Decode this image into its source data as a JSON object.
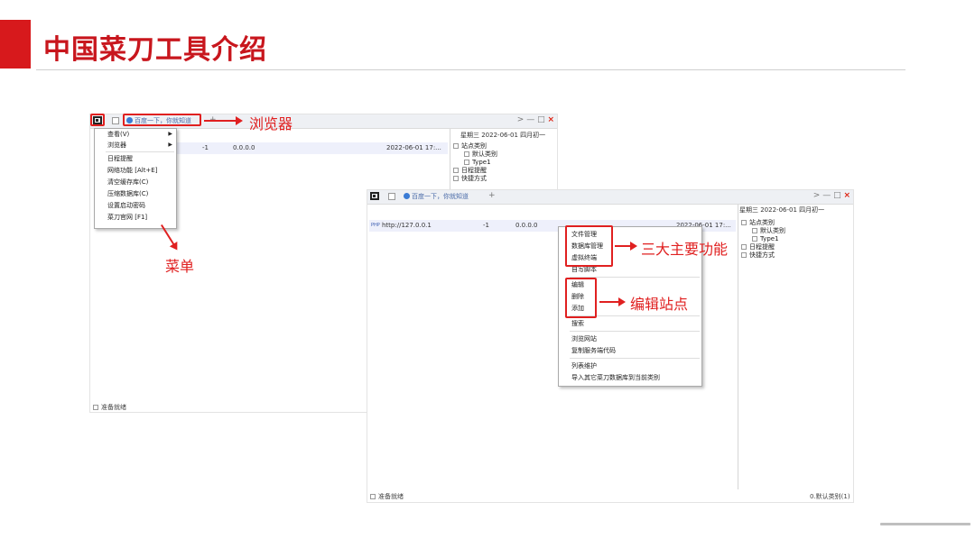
{
  "slide": {
    "title": "中国菜刀工具介绍"
  },
  "window1": {
    "tab_label": "百度一下，你就知道",
    "tab_plus": "+",
    "window_controls": {
      "forward": ">",
      "minimize": "—",
      "maximize": "□",
      "close": "×"
    },
    "date_text": "星期三 2022-06-01 四月初一",
    "row": {
      "num": "-1",
      "ip": "0.0.0.0",
      "time": "2022-06-01 17:..."
    },
    "tree": [
      "站点类别",
      "默认类别",
      "Type1",
      "日程提醒",
      "快捷方式"
    ],
    "status": "准备就绪",
    "menu": [
      "查看(V)",
      "浏览器",
      "日程提醒",
      "网络功能 [Alt+E]",
      "清空缓存库(C)",
      "压缩数据库(C)",
      "设置启动密码",
      "菜刀官网 [F1]"
    ]
  },
  "window2": {
    "tab_label": "百度一下，你就知道",
    "tab_plus": "+",
    "window_controls": {
      "forward": ">",
      "minimize": "—",
      "maximize": "□",
      "close": "×"
    },
    "date_text": "星期三 2022-06-01 四月初一",
    "row": {
      "icon": "PHP",
      "url": "http://127.0.0.1",
      "num": "-1",
      "ip": "0.0.0.0",
      "time": "2022-06-01 17:..."
    },
    "tree": [
      "站点类别",
      "默认类别",
      "Type1",
      "日程提醒",
      "快捷方式"
    ],
    "status": "准备就绪",
    "status_right": "0.默认类别(1)",
    "menu": [
      "文件管理",
      "数据库管理",
      "虚拟终端",
      "自写脚本",
      "编辑",
      "删除",
      "添加",
      "搜索",
      "浏览网站",
      "复制服务端代码",
      "列表维护",
      "导入其它菜刀数据库到当前类别"
    ]
  },
  "annotations": {
    "browser": "浏览器",
    "menu": "菜单",
    "main_functions": "三大主要功能",
    "edit_site": "编辑站点"
  },
  "colors": {
    "accent": "#d7191c",
    "annotation": "#e02020"
  }
}
